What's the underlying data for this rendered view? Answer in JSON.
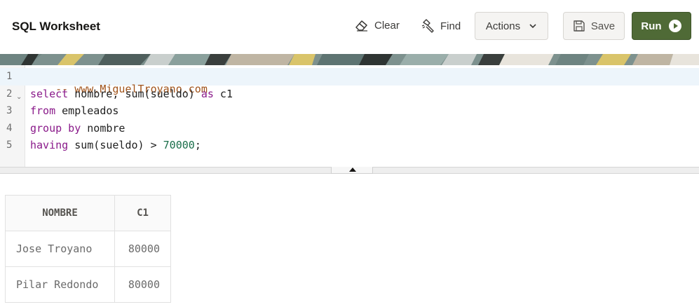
{
  "header": {
    "title": "SQL Worksheet",
    "clear_label": "Clear",
    "find_label": "Find",
    "actions_label": "Actions",
    "save_label": "Save",
    "run_label": "Run"
  },
  "icons": {
    "clear": "eraser-icon",
    "find": "flashlight-icon",
    "actions": "chevron-down-icon",
    "save": "floppy-disk-icon",
    "run": "play-circle-icon"
  },
  "colors": {
    "run_button": "#4f6a36",
    "keyword": "#8a1a8a",
    "comment": "#a0531a",
    "number": "#1a6e4a",
    "active_line": "#edf5fb"
  },
  "editor": {
    "line_numbers": [
      "1",
      "2",
      "3",
      "4",
      "5"
    ],
    "active_line": 1,
    "lines": [
      {
        "tokens": [
          {
            "type": "comment",
            "text": "-- www.MiguelTroyano.com"
          }
        ]
      },
      {
        "tokens": [
          {
            "type": "kw",
            "text": "select"
          },
          {
            "type": "plain",
            "text": " nombre, sum(sueldo) "
          },
          {
            "type": "kw",
            "text": "as"
          },
          {
            "type": "plain",
            "text": " c1"
          }
        ]
      },
      {
        "tokens": [
          {
            "type": "kw",
            "text": "from"
          },
          {
            "type": "plain",
            "text": " empleados"
          }
        ]
      },
      {
        "tokens": [
          {
            "type": "kw",
            "text": "group by"
          },
          {
            "type": "plain",
            "text": " nombre"
          }
        ]
      },
      {
        "tokens": [
          {
            "type": "kw",
            "text": "having"
          },
          {
            "type": "plain",
            "text": " sum(sueldo) > "
          },
          {
            "type": "num",
            "text": "70000"
          },
          {
            "type": "plain",
            "text": ";"
          }
        ]
      }
    ]
  },
  "results": {
    "columns": [
      "NOMBRE",
      "C1"
    ],
    "rows": [
      [
        "Jose Troyano",
        "80000"
      ],
      [
        "Pilar Redondo",
        "80000"
      ]
    ]
  }
}
